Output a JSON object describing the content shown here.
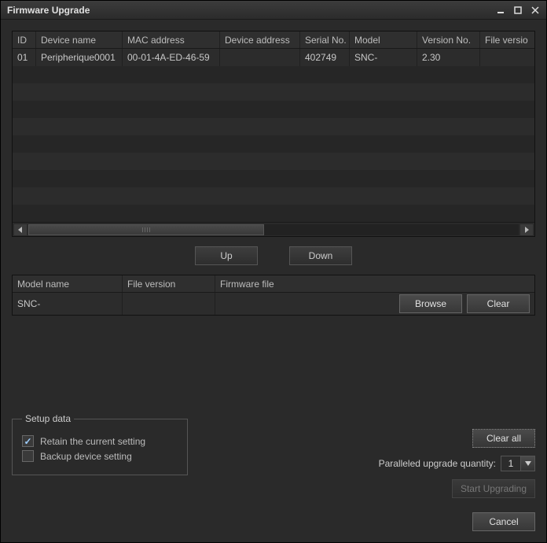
{
  "window": {
    "title": "Firmware Upgrade"
  },
  "deviceGrid": {
    "columns": {
      "id": "ID",
      "name": "Device name",
      "mac": "MAC address",
      "addr": "Device address",
      "serial": "Serial No.",
      "model": "Model",
      "ver": "Version No.",
      "filever": "File versio"
    },
    "rows": [
      {
        "id": "01",
        "name": "Peripherique0001",
        "mac": "00-01-4A-ED-46-59",
        "addr": "",
        "serial": "402749",
        "model": "SNC-",
        "ver": "2.30",
        "filever": ""
      }
    ]
  },
  "orderButtons": {
    "up": "Up",
    "down": "Down"
  },
  "firmwareGrid": {
    "columns": {
      "model": "Model name",
      "filever": "File version",
      "file": "Firmware file"
    },
    "row": {
      "model": "SNC-",
      "filever": "",
      "file": ""
    },
    "browse": "Browse",
    "clear": "Clear"
  },
  "setup": {
    "legend": "Setup data",
    "retain": "Retain the current setting",
    "backup": "Backup device setting",
    "retain_checked": true,
    "backup_checked": false
  },
  "actions": {
    "clearall": "Clear all",
    "paralleled_label": "Paralleled upgrade quantity:",
    "paralleled_value": "1",
    "start": "Start Upgrading",
    "cancel": "Cancel"
  }
}
